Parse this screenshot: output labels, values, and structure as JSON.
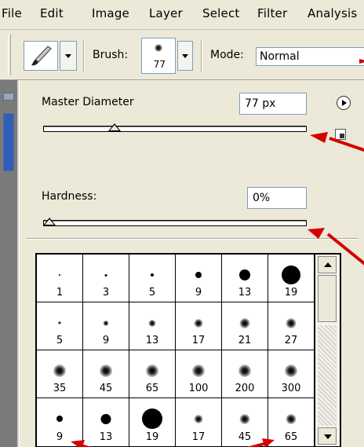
{
  "menubar": {
    "items": [
      "File",
      "Edit",
      "Image",
      "Layer",
      "Select",
      "Filter",
      "Analysis"
    ]
  },
  "options": {
    "brush_label": "Brush:",
    "brush_size": "77",
    "mode_label": "Mode:",
    "mode_value": "Normal"
  },
  "panel": {
    "master_diameter_label": "Master Diameter",
    "master_diameter_value": "77 px",
    "master_diameter_fraction": 0.26,
    "hardness_label": "Hardness:",
    "hardness_value": "0%",
    "hardness_fraction": 0.0
  },
  "brushes": [
    {
      "size": "1",
      "dot": 2,
      "soft": false
    },
    {
      "size": "3",
      "dot": 3,
      "soft": false
    },
    {
      "size": "5",
      "dot": 4,
      "soft": false
    },
    {
      "size": "9",
      "dot": 8,
      "soft": false
    },
    {
      "size": "13",
      "dot": 14,
      "soft": false
    },
    {
      "size": "19",
      "dot": 24,
      "soft": false
    },
    {
      "size": "5",
      "dot": 4,
      "soft": true
    },
    {
      "size": "9",
      "dot": 7,
      "soft": true
    },
    {
      "size": "13",
      "dot": 9,
      "soft": true
    },
    {
      "size": "17",
      "dot": 11,
      "soft": true
    },
    {
      "size": "21",
      "dot": 13,
      "soft": true
    },
    {
      "size": "27",
      "dot": 13,
      "soft": true
    },
    {
      "size": "35",
      "dot": 16,
      "soft": true
    },
    {
      "size": "45",
      "dot": 16,
      "soft": true
    },
    {
      "size": "65",
      "dot": 16,
      "soft": true
    },
    {
      "size": "100",
      "dot": 16,
      "soft": true
    },
    {
      "size": "200",
      "dot": 16,
      "soft": true
    },
    {
      "size": "300",
      "dot": 16,
      "soft": true
    },
    {
      "size": "9",
      "dot": 8,
      "soft": false
    },
    {
      "size": "13",
      "dot": 13,
      "soft": false
    },
    {
      "size": "19",
      "dot": 26,
      "soft": false
    },
    {
      "size": "17",
      "dot": 11,
      "soft": true
    },
    {
      "size": "45",
      "dot": 13,
      "soft": true
    },
    {
      "size": "65",
      "dot": 13,
      "soft": true
    }
  ],
  "colors": {
    "annotation_red": "#d40000"
  }
}
